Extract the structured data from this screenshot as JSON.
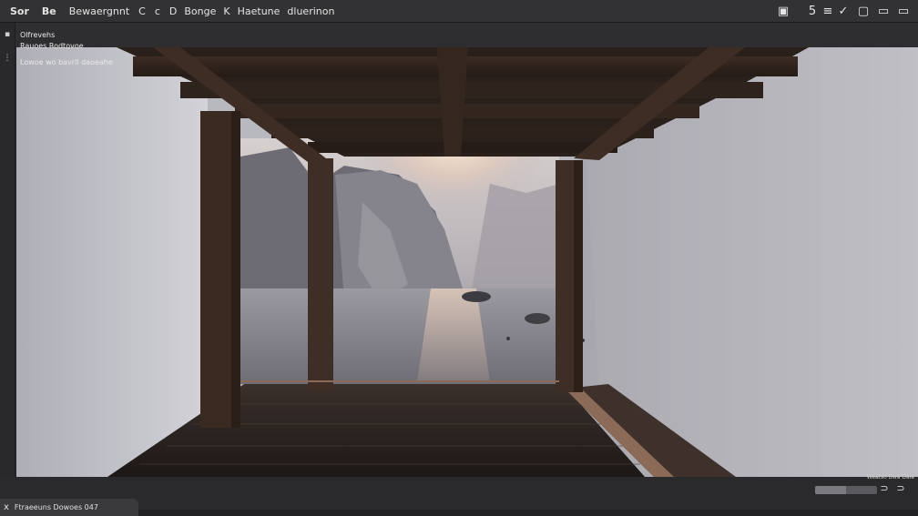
{
  "menubar": {
    "items": [
      {
        "label": "Sor"
      },
      {
        "label": "Be"
      },
      {
        "label": "Bewaergnnt"
      },
      {
        "label": "C"
      },
      {
        "label": "c"
      },
      {
        "label": "D"
      },
      {
        "label": "Bonge"
      },
      {
        "label": "K"
      },
      {
        "label": "Haetune"
      },
      {
        "label": "dluerinon"
      }
    ],
    "tools": [
      {
        "icon": "panel-icon",
        "glyph": "▣"
      },
      {
        "icon": "split-icon",
        "glyph": "5"
      },
      {
        "icon": "edit-icon",
        "glyph": "≡"
      },
      {
        "icon": "check-icon",
        "glyph": "✓"
      },
      {
        "icon": "frame-icon",
        "glyph": "▢"
      },
      {
        "icon": "window-icon",
        "glyph": "▭"
      },
      {
        "icon": "maximize-icon",
        "glyph": "▭"
      }
    ]
  },
  "info": {
    "line1": "Olfrevehs",
    "line2": "Rauoes  Rodtovoe",
    "line3": "Lowoe wo bavrll daoeahe"
  },
  "viewport": {
    "scene": "wooden-pavilion-cliff-view"
  },
  "status": {
    "label": "Ftraeeuns Dowoes 047",
    "close_icon": "x"
  },
  "nav": {
    "label": "Weatso Bwa Daia",
    "progress": 0.5
  },
  "colors": {
    "chrome": "#323234",
    "accent": "#5a5a5e"
  }
}
